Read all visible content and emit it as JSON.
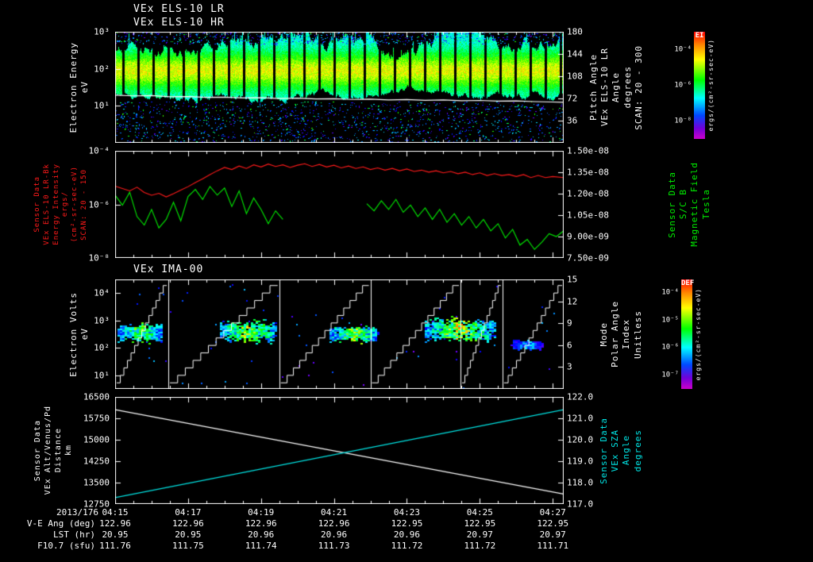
{
  "header_titles": {
    "els_lr": "VEx ELS-10 LR",
    "els_hr": "VEx ELS-10 HR",
    "ima": "VEx IMA-00"
  },
  "accent_colors": {
    "red": "#ff1a1a",
    "green": "#00ee00",
    "cyan": "#00e6e6",
    "white": "#ffffff",
    "background": "#000000"
  },
  "panels": {
    "p1": {
      "left_axis_label_lines": [
        "Electron Energy",
        "eV"
      ],
      "left_label_color": "#ffffff",
      "left_ticks": [
        "10³",
        "10²",
        "10¹"
      ],
      "left_tick_fracs": [
        0,
        0.333,
        0.667
      ],
      "right_ticks": [
        "180",
        "144",
        "108",
        "72",
        "36"
      ],
      "right_tick_fracs": [
        0,
        0.2,
        0.4,
        0.6,
        0.8
      ],
      "right_axis_label_lines": [
        "Pitch Angle",
        "VEx ELS-10 LR",
        "Angle",
        "degrees",
        "SCAN: 20 - 300"
      ],
      "right_label_color": "#ffffff"
    },
    "p2": {
      "left_axis_label_lines": [
        "Sensor Data",
        "VEx ELS-10 LR-Bk",
        "Energy Intensity",
        "ergs/",
        "(cm²-sr-sec-eV)",
        "SCAN: 20 - 150"
      ],
      "left_label_color": "#ff1a1a",
      "left_ticks": [
        "10⁻⁴",
        "10⁻⁶",
        "10⁻⁸"
      ],
      "left_tick_fracs": [
        0,
        0.5,
        1
      ],
      "right_ticks": [
        "1.50e-08",
        "1.35e-08",
        "1.20e-08",
        "1.05e-08",
        "9.00e-09",
        "7.50e-09"
      ],
      "right_tick_fracs": [
        0,
        0.2,
        0.4,
        0.6,
        0.8,
        1
      ],
      "right_axis_label_lines": [
        "Sensor Data",
        "S/C B",
        "Magnetic Field",
        "Tesla"
      ],
      "right_label_color": "#00ee00"
    },
    "p3": {
      "left_axis_label_lines": [
        "Electron Volts",
        "eV"
      ],
      "left_label_color": "#ffffff",
      "left_ticks": [
        "10⁴",
        "10³",
        "10²",
        "10¹"
      ],
      "left_tick_fracs": [
        0.125,
        0.375,
        0.625,
        0.875
      ],
      "right_ticks": [
        "15",
        "12",
        "9",
        "6",
        "3"
      ],
      "right_tick_fracs": [
        0,
        0.2,
        0.4,
        0.6,
        0.8
      ],
      "right_axis_label_lines": [
        "Mode",
        "Polar Angle",
        "Index",
        "Unitless"
      ],
      "right_label_color": "#ffffff"
    },
    "p4": {
      "left_axis_label_lines": [
        "Sensor Data",
        "VEx Alt/Venus/Pd",
        "Distance",
        "km"
      ],
      "left_label_color": "#ffffff",
      "left_ticks": [
        "16500",
        "15750",
        "15000",
        "14250",
        "13500",
        "12750"
      ],
      "left_tick_fracs": [
        0,
        0.2,
        0.4,
        0.6,
        0.8,
        1
      ],
      "right_ticks": [
        "122.0",
        "121.0",
        "120.0",
        "119.0",
        "118.0",
        "117.0"
      ],
      "right_tick_fracs": [
        0,
        0.2,
        0.4,
        0.6,
        0.8,
        1
      ],
      "right_axis_label_lines": [
        "Sensor Data",
        "VEx SZA",
        "Angle",
        "degrees"
      ],
      "right_label_color": "#00e6e6"
    }
  },
  "colorbars": [
    {
      "top_label": "EI",
      "ticks": [
        "10⁻⁴",
        "10⁻⁶",
        "10⁻⁸"
      ],
      "unit": "ergs/(cm²-sr-sec-eV)"
    },
    {
      "top_label": "DEF",
      "ticks": [
        "10⁻⁴",
        "10⁻⁵",
        "10⁻⁶",
        "10⁻⁷"
      ],
      "unit": "ergs/(cm²-sr-sec-eV)"
    }
  ],
  "bottom_axis": {
    "date": "2013/176",
    "time_ticks": [
      "04:15",
      "04:17",
      "04:19",
      "04:21",
      "04:23",
      "04:25",
      "04:27"
    ],
    "rows": [
      {
        "label": "V-E Ang (deg)",
        "values": [
          "122.96",
          "122.96",
          "122.96",
          "122.96",
          "122.95",
          "122.95",
          "122.95"
        ]
      },
      {
        "label": "LST (hr)",
        "values": [
          "20.95",
          "20.95",
          "20.96",
          "20.96",
          "20.96",
          "20.97",
          "20.97"
        ]
      },
      {
        "label": "F10.7 (sfu)",
        "values": [
          "111.76",
          "111.75",
          "111.74",
          "111.73",
          "111.72",
          "111.72",
          "111.71"
        ]
      }
    ]
  },
  "chart_data": [
    {
      "id": "p1",
      "type": "heatmap",
      "title": "VEx ELS-10 LR/HR electron energy-time spectrogram",
      "x_start_time": "04:15",
      "x_minutes_range": [
        0,
        12.3
      ],
      "y_axis": {
        "label": "Electron Energy (eV)",
        "scale": "log",
        "range": [
          1,
          1000
        ]
      },
      "color_axis": {
        "label": "EI ergs/(cm²-sr-sec-eV)",
        "scale": "log",
        "range": [
          1e-09,
          0.0001
        ]
      },
      "band": {
        "e_min_eV": 22,
        "e_max_eV": 420,
        "e_peak_eV": 90,
        "scan_gap_minutes": 0.41
      },
      "speckle": {
        "low_energy_eV": [
          1,
          14
        ],
        "high_energy_eV": [
          450,
          1000
        ]
      },
      "overlay_line": {
        "name": "spacecraft-potential-line",
        "color": "#ffffff",
        "points": [
          [
            0,
            19.5
          ],
          [
            0.5,
            18.6
          ],
          [
            1,
            18.9
          ],
          [
            1.5,
            17.6
          ],
          [
            2,
            17.9
          ],
          [
            2.5,
            16.9
          ],
          [
            3,
            17.2
          ],
          [
            3.5,
            16.3
          ],
          [
            4,
            16.6
          ],
          [
            4.5,
            15.8
          ],
          [
            5,
            16.1
          ],
          [
            5.5,
            15.3
          ],
          [
            6,
            15.6
          ],
          [
            6.5,
            14.9
          ],
          [
            7,
            15.2
          ],
          [
            7.5,
            14.5
          ],
          [
            8,
            14.8
          ],
          [
            8.5,
            14.1
          ],
          [
            9,
            14.4
          ],
          [
            9.5,
            13.7
          ],
          [
            10,
            14
          ],
          [
            10.5,
            13.4
          ],
          [
            11,
            13.6
          ],
          [
            11.5,
            13
          ],
          [
            12,
            12.7
          ],
          [
            12.3,
            12.5
          ]
        ]
      }
    },
    {
      "id": "p2",
      "type": "line",
      "x_minutes_range": [
        0,
        12.3
      ],
      "left_axis": {
        "label": "Energy Intensity ergs/(cm²-sr-sec-eV)",
        "scale": "log",
        "range": [
          1e-08,
          0.0001
        ]
      },
      "right_axis": {
        "label": "Magnetic Field (Tesla)",
        "scale": "linear",
        "range": [
          7.5e-09,
          1.5e-08
        ]
      },
      "series": [
        {
          "name": "VEx ELS-10 LR-Bk Energy Intensity SCAN: 20 - 150",
          "axis": "left",
          "color": "#ff1a1a",
          "segments": [
            [
              [
                0,
                4.8e-06
              ],
              [
                0.2,
                3.9e-06
              ],
              [
                0.4,
                3.2e-06
              ],
              [
                0.6,
                4.4e-06
              ],
              [
                0.8,
                2.8e-06
              ],
              [
                1,
                2.2e-06
              ],
              [
                1.2,
                2.6e-06
              ],
              [
                1.4,
                1.9e-06
              ],
              [
                1.6,
                2.5e-06
              ],
              [
                1.8,
                3.4e-06
              ],
              [
                2,
                4.6e-06
              ],
              [
                2.2,
                6.5e-06
              ],
              [
                2.4,
                9e-06
              ],
              [
                2.6,
                1.3e-05
              ],
              [
                2.8,
                1.8e-05
              ],
              [
                3,
                2.4e-05
              ],
              [
                3.2,
                2e-05
              ],
              [
                3.4,
                2.7e-05
              ],
              [
                3.6,
                2.2e-05
              ],
              [
                3.8,
                3e-05
              ],
              [
                4,
                2.5e-05
              ],
              [
                4.2,
                3.2e-05
              ],
              [
                4.4,
                2.6e-05
              ],
              [
                4.6,
                3e-05
              ],
              [
                4.8,
                2.4e-05
              ],
              [
                5,
                2.9e-05
              ],
              [
                5.2,
                3.3e-05
              ],
              [
                5.4,
                2.6e-05
              ],
              [
                5.6,
                3.1e-05
              ],
              [
                5.8,
                2.5e-05
              ],
              [
                6,
                2.9e-05
              ],
              [
                6.2,
                2.3e-05
              ],
              [
                6.4,
                2.7e-05
              ],
              [
                6.6,
                2.2e-05
              ],
              [
                6.8,
                2.5e-05
              ],
              [
                7,
                2e-05
              ],
              [
                7.2,
                2.3e-05
              ],
              [
                7.4,
                1.9e-05
              ],
              [
                7.6,
                2.2e-05
              ],
              [
                7.8,
                1.8e-05
              ],
              [
                8,
                2.1e-05
              ],
              [
                8.2,
                1.7e-05
              ],
              [
                8.4,
                1.9e-05
              ],
              [
                8.6,
                1.6e-05
              ],
              [
                8.8,
                1.8e-05
              ],
              [
                9,
                1.5e-05
              ],
              [
                9.2,
                1.7e-05
              ],
              [
                9.4,
                1.4e-05
              ],
              [
                9.6,
                1.6e-05
              ],
              [
                9.8,
                1.3e-05
              ],
              [
                10,
                1.5e-05
              ],
              [
                10.2,
                1.2e-05
              ],
              [
                10.4,
                1.4e-05
              ],
              [
                10.6,
                1.2e-05
              ],
              [
                10.8,
                1.3e-05
              ],
              [
                11,
                1.1e-05
              ],
              [
                11.2,
                1.3e-05
              ],
              [
                11.4,
                1e-05
              ],
              [
                11.6,
                1.2e-05
              ],
              [
                11.8,
                1e-05
              ],
              [
                12,
                1.1e-05
              ],
              [
                12.3,
                1e-05
              ]
            ]
          ]
        },
        {
          "name": "S/C B Magnetic Field (Tesla)",
          "axis": "right",
          "color": "#00ee00",
          "segments": [
            [
              [
                0,
                1.19e-08
              ],
              [
                0.2,
                1.12e-08
              ],
              [
                0.4,
                1.21e-08
              ],
              [
                0.6,
                1.04e-08
              ],
              [
                0.8,
                9.8e-09
              ],
              [
                1,
                1.09e-08
              ],
              [
                1.2,
                9.6e-09
              ],
              [
                1.4,
                1.02e-08
              ],
              [
                1.6,
                1.14e-08
              ],
              [
                1.8,
                1.01e-08
              ],
              [
                2,
                1.18e-08
              ],
              [
                2.2,
                1.23e-08
              ],
              [
                2.4,
                1.16e-08
              ],
              [
                2.6,
                1.25e-08
              ],
              [
                2.8,
                1.19e-08
              ],
              [
                3,
                1.24e-08
              ],
              [
                3.2,
                1.11e-08
              ],
              [
                3.4,
                1.22e-08
              ],
              [
                3.6,
                1.06e-08
              ],
              [
                3.8,
                1.17e-08
              ],
              [
                4,
                1.09e-08
              ],
              [
                4.2,
                9.9e-09
              ],
              [
                4.4,
                1.08e-08
              ],
              [
                4.6,
                1.02e-08
              ]
            ],
            [
              [
                6.9,
                1.13e-08
              ],
              [
                7.1,
                1.08e-08
              ],
              [
                7.3,
                1.15e-08
              ],
              [
                7.5,
                1.09e-08
              ],
              [
                7.7,
                1.16e-08
              ],
              [
                7.9,
                1.07e-08
              ],
              [
                8.1,
                1.12e-08
              ],
              [
                8.3,
                1.04e-08
              ],
              [
                8.5,
                1.1e-08
              ],
              [
                8.7,
                1.02e-08
              ],
              [
                8.9,
                1.09e-08
              ],
              [
                9.1,
                1e-08
              ],
              [
                9.3,
                1.06e-08
              ],
              [
                9.5,
                9.8e-09
              ],
              [
                9.7,
                1.04e-08
              ],
              [
                9.9,
                9.6e-09
              ],
              [
                10.1,
                1.02e-08
              ],
              [
                10.3,
                9.4e-09
              ],
              [
                10.5,
                9.9e-09
              ],
              [
                10.7,
                8.9e-09
              ],
              [
                10.9,
                9.5e-09
              ],
              [
                11.1,
                8.4e-09
              ],
              [
                11.3,
                8.8e-09
              ],
              [
                11.5,
                8.1e-09
              ],
              [
                11.7,
                8.6e-09
              ],
              [
                11.9,
                9.2e-09
              ],
              [
                12.1,
                9e-09
              ],
              [
                12.3,
                9.4e-09
              ]
            ]
          ]
        }
      ]
    },
    {
      "id": "p3",
      "type": "heatmap",
      "title": "VEx IMA-00 ion energy-time spectrogram",
      "x_minutes_range": [
        0,
        12.3
      ],
      "y_axis": {
        "label": "Electron Volts (eV)",
        "scale": "log",
        "range": [
          3.16,
          31623
        ]
      },
      "right_axis": {
        "label": "Mode / Polar Angle Index (Unitless)",
        "range": [
          0,
          15
        ]
      },
      "color_axis": {
        "label": "DEF ergs/(cm²-sr-sec-eV)",
        "scale": "log",
        "range": [
          1e-08,
          0.0001
        ]
      },
      "mode_dividers_minutes": [
        1.46,
        4.5,
        7.0,
        9.47,
        10.62
      ],
      "polar_angle_sweeps": "white staircase ramps 0 to 15 within each mode segment",
      "blobs": [
        {
          "t0": 0.1,
          "t1": 1.3,
          "logE_center": 2.55,
          "logE_spread": 0.25,
          "intensity": 0.8
        },
        {
          "t0": 2.9,
          "t1": 4.4,
          "logE_center": 2.6,
          "logE_spread": 0.3,
          "intensity": 0.9
        },
        {
          "t0": 5.9,
          "t1": 7.2,
          "logE_center": 2.5,
          "logE_spread": 0.22,
          "intensity": 0.85
        },
        {
          "t0": 8.5,
          "t1": 10.4,
          "logE_center": 2.65,
          "logE_spread": 0.33,
          "intensity": 0.9
        },
        {
          "t0": 10.9,
          "t1": 11.7,
          "logE_center": 2.1,
          "logE_spread": 0.12,
          "intensity": 0.45
        }
      ]
    },
    {
      "id": "p4",
      "type": "line",
      "x_minutes_range": [
        0,
        12.3
      ],
      "left_axis": {
        "label": "VEx Alt/Venus/Pd Distance (km)",
        "range": [
          12750,
          16500
        ]
      },
      "right_axis": {
        "label": "VEx SZA (degrees)",
        "range": [
          117,
          122
        ]
      },
      "series": [
        {
          "name": "VEx Alt/Venus/Pd Distance",
          "axis": "left",
          "color": "#ffffff",
          "segments": [
            [
              [
                0,
                16050
              ],
              [
                12.3,
                13100
              ]
            ]
          ]
        },
        {
          "name": "VEx SZA",
          "axis": "right",
          "color": "#00e6e6",
          "segments": [
            [
              [
                0,
                117.3
              ],
              [
                12.3,
                121.4
              ]
            ]
          ]
        }
      ]
    }
  ]
}
